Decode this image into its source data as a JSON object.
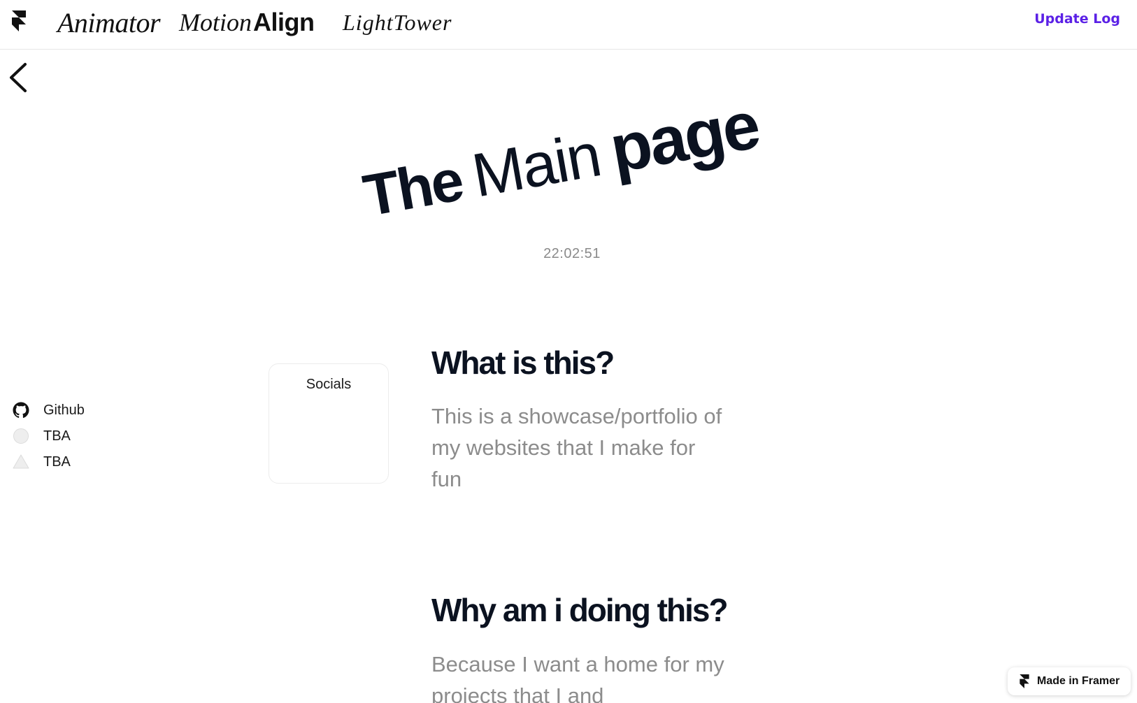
{
  "nav": {
    "logo_icon": "framer-logo-icon",
    "links": {
      "animator": "Animator",
      "motion_part1": "Motion",
      "motion_part2": "Align",
      "lighttower": "LightTower"
    },
    "update_log": "Update Log"
  },
  "back_icon": "chevron-left-icon",
  "hero": {
    "word1": "The",
    "word2": "Main",
    "word3": "page",
    "time": "22:02:51"
  },
  "socials": {
    "title": "Socials",
    "items": [
      {
        "label": "Github",
        "icon": "github-icon"
      },
      {
        "label": "TBA",
        "icon": "circle-icon"
      },
      {
        "label": "TBA",
        "icon": "triangle-icon"
      }
    ]
  },
  "sections": [
    {
      "title": "What is this?",
      "body": "This is a showcase/portfolio of my websites that I make for fun"
    },
    {
      "title": "Why am i doing this?",
      "body": "Because I want a home for my projects that I and"
    }
  ],
  "badge": {
    "label": "Made in Framer",
    "icon": "framer-logo-icon"
  },
  "colors": {
    "accent": "#5b21e6",
    "text": "#0b1220",
    "muted": "#8c8c8c"
  }
}
